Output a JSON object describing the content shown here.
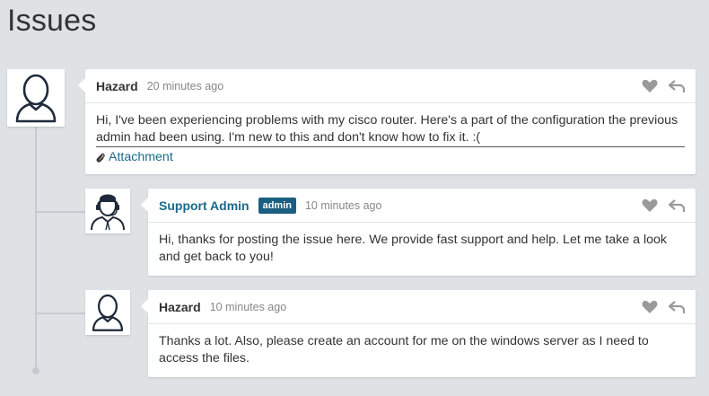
{
  "page": {
    "title": "Issues"
  },
  "comments": [
    {
      "author": "Hazard",
      "time": "20 minutes ago",
      "message": "Hi, I've been experiencing problems with my cisco router. Here's a part of the configuration the previous admin had been using. I'm new to this and don't know how to fix it. :(",
      "attachment_label": "Attachment",
      "avatar_icon": "user-icon"
    },
    {
      "author": "Support Admin",
      "badge": "admin",
      "time": "10 minutes ago",
      "message": "Hi, thanks for posting the issue here. We provide fast support and help. Let me take a look and get back to you!",
      "avatar_icon": "support-agent-icon"
    },
    {
      "author": "Hazard",
      "time": "10 minutes ago",
      "message": "Thanks a lot. Also, please create an account for me on the windows server as I need to access the files.",
      "avatar_icon": "user-icon"
    }
  ],
  "icons": {
    "like": "heart-icon",
    "reply": "reply-icon",
    "attachment": "paperclip-icon"
  },
  "colors": {
    "background": "#dfe2e5",
    "link": "#1a6a8a",
    "badge": "#1b5f80",
    "icon": "#9a9a9a"
  }
}
